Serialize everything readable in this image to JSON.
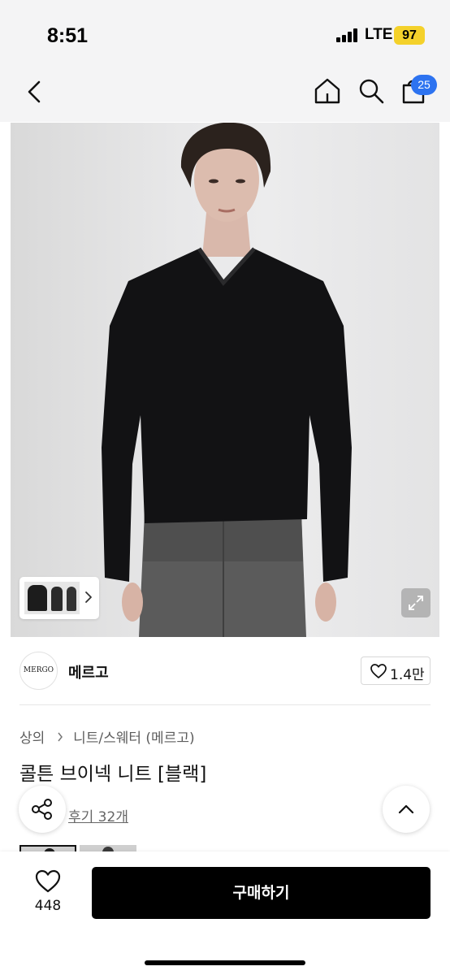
{
  "status_bar": {
    "time": "8:51",
    "network": "LTE",
    "battery": "97",
    "battery_color": "#f4d12b"
  },
  "nav": {
    "icons": [
      "back-icon",
      "home-icon",
      "search-icon",
      "cart-icon"
    ],
    "cart_badge": "25",
    "badge_color": "#2d73f0"
  },
  "brand": {
    "logo_text": "MERGO",
    "name": "메르고",
    "like_count": "1.4만"
  },
  "breadcrumb": {
    "category": "상의",
    "subcategory": "니트/스웨터 (메르고)"
  },
  "product": {
    "title": "콜튼 브이넥 니트 [블랙]",
    "review_link": "후기 32개"
  },
  "bottom_bar": {
    "wish_count": "448",
    "buy_label": "구매하기"
  }
}
